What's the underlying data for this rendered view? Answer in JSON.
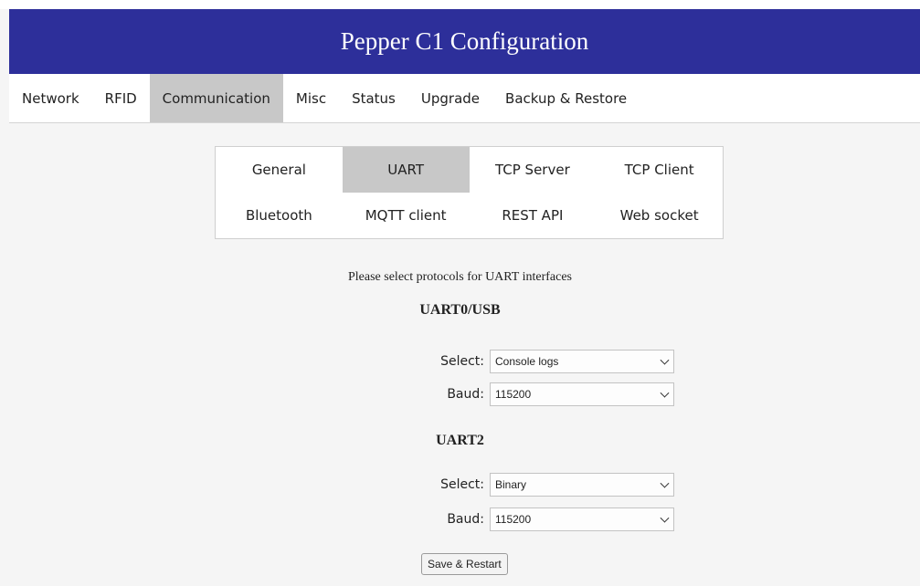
{
  "header": {
    "title": "Pepper C1 Configuration"
  },
  "nav": {
    "items": [
      {
        "label": "Network"
      },
      {
        "label": "RFID"
      },
      {
        "label": "Communication",
        "active": true
      },
      {
        "label": "Misc"
      },
      {
        "label": "Status"
      },
      {
        "label": "Upgrade"
      },
      {
        "label": "Backup & Restore"
      }
    ]
  },
  "subnav": {
    "items": [
      {
        "label": "General"
      },
      {
        "label": "UART",
        "active": true
      },
      {
        "label": "TCP Server"
      },
      {
        "label": "TCP Client"
      },
      {
        "label": "Bluetooth"
      },
      {
        "label": "MQTT client"
      },
      {
        "label": "REST API"
      },
      {
        "label": "Web socket"
      }
    ]
  },
  "content": {
    "intro": "Please select protocols for UART interfaces",
    "uart0": {
      "title": "UART0/USB",
      "select_label": "Select:",
      "select_value": "Console logs",
      "baud_label": "Baud:",
      "baud_value": "115200"
    },
    "uart2": {
      "title": "UART2",
      "select_label": "Select:",
      "select_value": "Binary",
      "baud_label": "Baud:",
      "baud_value": "115200"
    },
    "save_label": "Save & Restart"
  },
  "colors": {
    "header_bg": "#2d2f9a",
    "active_tab_bg": "#c8c8c8",
    "page_bg": "#f5f5f5"
  }
}
